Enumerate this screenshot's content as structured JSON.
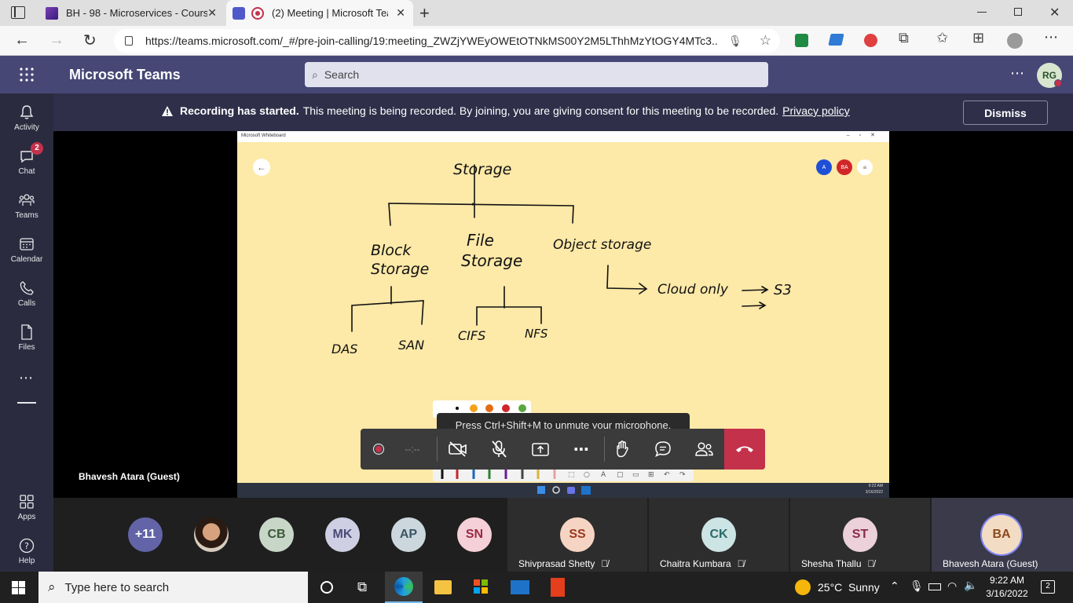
{
  "browser": {
    "tabs": [
      {
        "title": "BH - 98 - Microservices - Course"
      },
      {
        "title": "(2) Meeting | Microsoft Tear"
      }
    ],
    "url": "https://teams.microsoft.com/_#/pre-join-calling/19:meeting_ZWZjYWEyOWEtOTNkMS00Y2M5LThhMzYtOGY4MTc3..."
  },
  "teams": {
    "app_title": "Microsoft Teams",
    "search_placeholder": "Search",
    "user_initials": "RG",
    "rail": [
      {
        "label": "Activity",
        "icon": "bell-icon"
      },
      {
        "label": "Chat",
        "icon": "chat-icon",
        "badge": "2"
      },
      {
        "label": "Teams",
        "icon": "teams-icon"
      },
      {
        "label": "Calendar",
        "icon": "calendar-icon"
      },
      {
        "label": "Calls",
        "icon": "phone-icon"
      },
      {
        "label": "Files",
        "icon": "file-icon"
      }
    ],
    "rail_bottom": [
      {
        "label": "Apps",
        "icon": "apps-icon"
      },
      {
        "label": "Help",
        "icon": "help-icon"
      }
    ]
  },
  "banner": {
    "bold": "Recording has started.",
    "text": "This meeting is being recorded. By joining, you are giving consent for this meeting to be recorded.",
    "link": "Privacy policy",
    "dismiss": "Dismiss"
  },
  "stage": {
    "presenter_name": "Bhavesh Atara (Guest)",
    "whiteboard_title": "Microsoft Whiteboard",
    "whiteboard_users": [
      "A",
      "BA"
    ],
    "whiteboard_time": "9:22 AM",
    "whiteboard_date": "3/16/2022",
    "sketch": {
      "root": "Storage",
      "branches": [
        "Block Storage",
        "File Storage",
        "Object storage"
      ],
      "block_children": [
        "DAS",
        "SAN"
      ],
      "file_children": [
        "CIFS",
        "NFS"
      ],
      "object_note": "Cloud only",
      "object_target": "S3"
    }
  },
  "controls": {
    "tooltip": "Press Ctrl+Shift+M to unmute your microphone.",
    "timer": "--:--"
  },
  "participants": {
    "overflow": "+11",
    "avatars": [
      {
        "initials": "CB",
        "color": "#c8d6c8"
      },
      {
        "initials": "MK",
        "color": "#cfcfe3"
      },
      {
        "initials": "AP",
        "color": "#cbd7dd"
      },
      {
        "initials": "SN",
        "color": "#f5d0d8"
      }
    ],
    "tiles": [
      {
        "initials": "SS",
        "name": "Shivprasad Shetty",
        "color": "#f6d4c4"
      },
      {
        "initials": "CK",
        "name": "Chaitra Kumbara",
        "color": "#cde4e4"
      },
      {
        "initials": "ST",
        "name": "Shesha Thallu",
        "color": "#ecd0da"
      },
      {
        "initials": "BA",
        "name": "Bhavesh Atara (Guest)",
        "color": "#f3dcc4"
      }
    ]
  },
  "taskbar": {
    "search_placeholder": "Type here to search",
    "weather": "25°C  Sunny",
    "time": "9:22 AM",
    "date": "3/16/2022",
    "notifications": "2"
  }
}
